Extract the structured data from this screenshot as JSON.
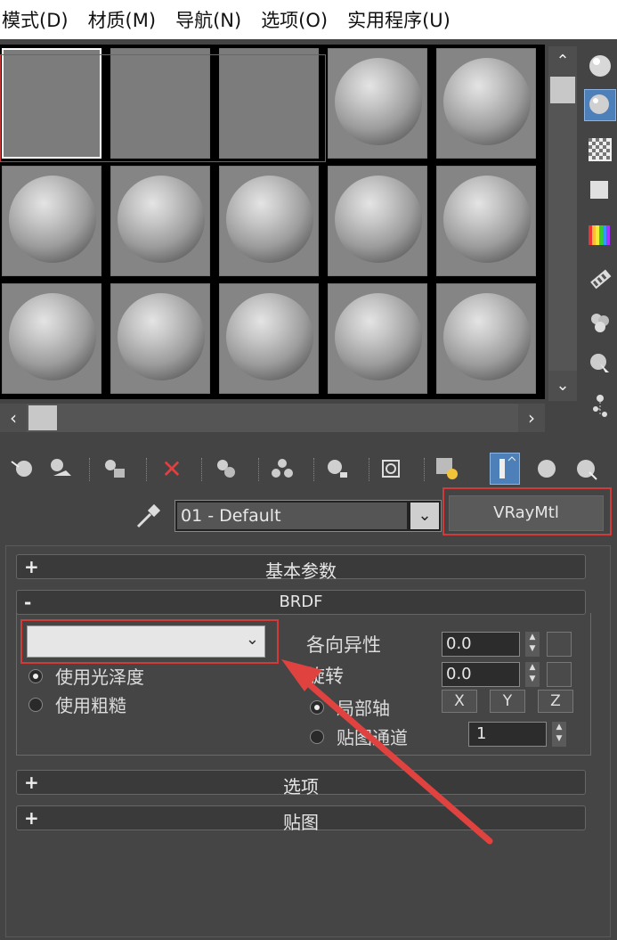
{
  "menu": {
    "items": [
      "模式(D)",
      "材质(M)",
      "导航(N)",
      "选项(O)",
      "实用程序(U)"
    ]
  },
  "slots": {
    "rows": 3,
    "cols": 5,
    "empty_count": 3
  },
  "scroll": {
    "up": "⌃",
    "down": "⌄",
    "left": "‹",
    "right": "›"
  },
  "side_tools": [
    "sample-type-icon",
    "backlight-icon",
    "checker-background-icon",
    "sample-uv-icon",
    "video-color-check-icon",
    "make-preview-icon",
    "options-icon",
    "select-by-material-icon",
    "material-map-navigator-icon"
  ],
  "toolbar": {
    "icons": [
      "get-material-icon",
      "put-to-scene-icon",
      "assign-to-selection-icon",
      "reset-map-icon",
      "make-unique-icon",
      "put-to-library-icon",
      "material-id-channel-icon",
      "show-map-icon",
      "show-end-result-icon",
      "go-to-parent-icon",
      "go-forward-icon"
    ],
    "delete_glyph": "✕"
  },
  "material": {
    "name": "01 - Default",
    "type": "VRayMtl"
  },
  "rollouts": {
    "basic": {
      "sign": "+",
      "title": "基本参数"
    },
    "brdf": {
      "sign": "-",
      "title": "BRDF"
    },
    "options": {
      "sign": "+",
      "title": "选项"
    },
    "maps": {
      "sign": "+",
      "title": "贴图"
    }
  },
  "brdf": {
    "type_value": "",
    "use_glossiness": "使用光泽度",
    "use_roughness": "使用粗糙",
    "anisotropy_label": "各向异性",
    "anisotropy_value": "0.0",
    "rotation_label": "旋转",
    "rotation_value": "0.0",
    "local_axis_label": "局部轴",
    "map_channel_label": "贴图通道",
    "axes": [
      "X",
      "Y",
      "Z"
    ],
    "map_channel_value": "1"
  },
  "colors": {
    "highlight": "#d23a3a",
    "active_blue": "#4d7fb8"
  }
}
